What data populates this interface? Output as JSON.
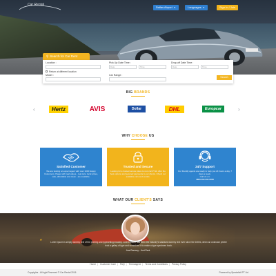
{
  "header": {
    "logo_text": "Car Rental",
    "airport_button": "Dallas Airport",
    "language_button": "Languages",
    "signin_button": "Sign In / Join",
    "caret": "▼"
  },
  "search": {
    "tab_label": "Search for Car Rent",
    "location_label": "Location :",
    "pickup_label": "Pick Up Date Time :",
    "dropoff_label": "Drop-off Date Time :",
    "pickup_date_placeholder": "Date",
    "pickup_time_placeholder": "Time",
    "dropoff_date_placeholder": "Date",
    "dropoff_time_placeholder": "Time",
    "return_checkbox_label": "Return at different location",
    "model_label": "Model :",
    "car_range_label": "Car Range :",
    "search_button": "Search"
  },
  "brands": {
    "heading_plain": "BIG",
    "heading_accent": "BRANDS",
    "prev_arrow": "‹",
    "next_arrow": "›",
    "items": [
      {
        "name": "Hertz",
        "color": "#1a1a1a",
        "bg": "#ffd200"
      },
      {
        "name": "AVIS",
        "color": "#d4002a",
        "bg": "#ffffff"
      },
      {
        "name": "Dollar",
        "color": "#ffffff",
        "bg": "#1d4fa3"
      },
      {
        "name": "DHL",
        "color": "#d40511",
        "bg": "#ffcc00"
      },
      {
        "name": "Europcar",
        "color": "#ffffff",
        "bg": "#0a9146"
      }
    ]
  },
  "why": {
    "heading_plain": "WHY",
    "heading_accent": "CHOOSE",
    "heading_end": "US",
    "boxes": [
      {
        "title": "Satisfied Customer",
        "desc": "We are looking an expert agent with over 1000 Happy Customers. Pages with real values - real cars, local prices, safe, affordable and clean - are available.",
        "icon": "handshake-icon"
      },
      {
        "title": "Trusted and Secure",
        "desc": "Looking for a trusted secure place to rent cars? We offer the best options and secured payments to our clients. Check our available cars and rentals.",
        "icon": "lock-icon"
      },
      {
        "title": "24/7 Support",
        "desc": "Our friendly agents are ready to help you 24 hours a day, 7 days a week.",
        "phone": "Call Us on:",
        "number": "1800 000 000 0000",
        "icon": "headset-icon"
      }
    ]
  },
  "testimonial": {
    "heading_plain": "WHAT OUR",
    "heading_accent": "CLIENT'S",
    "heading_end": "SAYS",
    "quote_mark": "“",
    "quote": "Lorem ipsum is simply dummy text of the printing and typesetting industry. Lorem Ipsum has been the industry's standard dummy text ever since the 1500s, when an unknown printer took a galley of type and scrambled it to make a type specimen book.",
    "author": "Ana Ramsey - Just Rent"
  },
  "footer": {
    "links": [
      "Home",
      "Customer Care",
      "FAQ",
      "Termsagree",
      "Terms and Conditions",
      "Privacy Policy"
    ],
    "separator": "|",
    "copyright": "Copyrights - All right Reserved © Car Rental 2016",
    "powered_by": "Powered by Specialist IPT Ltd"
  },
  "colors": {
    "accent": "#f2b41c",
    "blue": "#2f84cf",
    "footer_bg": "#f2f2f2"
  }
}
